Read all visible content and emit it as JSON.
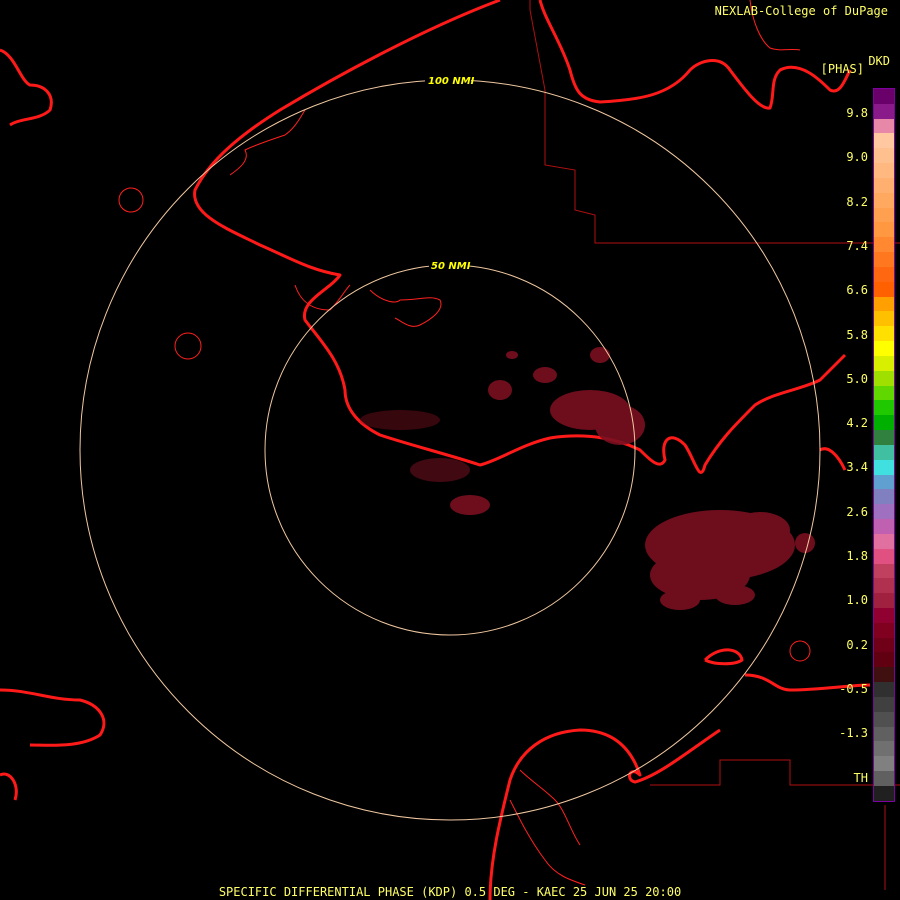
{
  "header": {
    "credit": "NEXLAB-College of DuPage",
    "product_code": "DKD",
    "unit": "[PHAS]"
  },
  "footer": {
    "caption": "SPECIFIC DIFFERENTIAL PHASE (KDP) 0.5 DEG - KAEC 25 JUN 25 20:00"
  },
  "range_rings": [
    {
      "label": "100 NMI",
      "range_nmi": 100
    },
    {
      "label": "50 NMI",
      "range_nmi": 50
    }
  ],
  "color_scale": {
    "tick_labels": [
      "9.8",
      "9.0",
      "8.2",
      "7.4",
      "6.6",
      "5.8",
      "5.0",
      "4.2",
      "3.4",
      "2.6",
      "1.8",
      "1.0",
      "0.2",
      "-0.5",
      "-1.3",
      "TH"
    ],
    "swatches": [
      "#6a006a",
      "#8a1a8a",
      "#e888a8",
      "#ffc8a0",
      "#ffc090",
      "#ffb880",
      "#ffb070",
      "#ffa860",
      "#ffa050",
      "#ff9840",
      "#ff8830",
      "#ff7820",
      "#ff6810",
      "#ff6000",
      "#ffa000",
      "#ffc000",
      "#ffe000",
      "#ffff00",
      "#d8f000",
      "#a0e000",
      "#60d800",
      "#20c800",
      "#00b000",
      "#308040",
      "#40c0a0",
      "#40e0e0",
      "#60a0d0",
      "#8080c0",
      "#a070c0",
      "#c060b0",
      "#e070a0",
      "#e05080",
      "#c04060",
      "#b03050",
      "#a02040",
      "#900030",
      "#800020",
      "#700018",
      "#600010",
      "#401010",
      "#303030",
      "#404040",
      "#505050",
      "#606060",
      "#707070",
      "#808080",
      "#606060",
      "#202020"
    ],
    "colors": {
      "label": "#ffff66",
      "border": "#7f00a0"
    }
  },
  "map_colors": {
    "coastline": "#ff1a1a",
    "ring": "#f0c8a0",
    "echo": "#7a1020"
  }
}
